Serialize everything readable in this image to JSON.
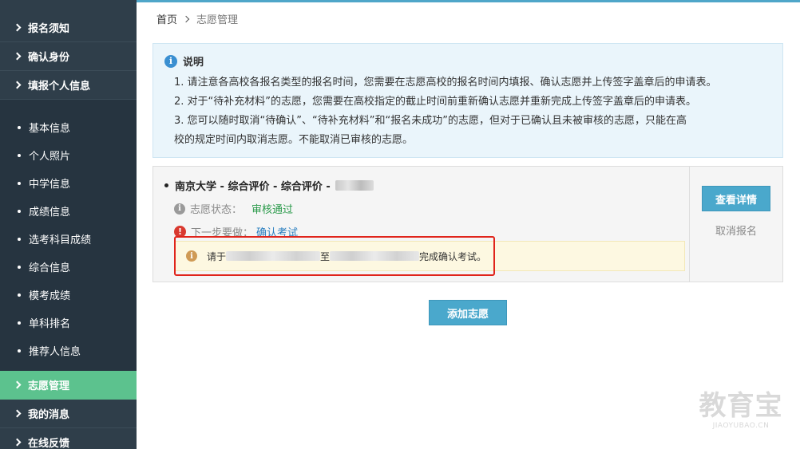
{
  "sidebar": {
    "top_items": [
      {
        "label": "报名须知"
      },
      {
        "label": "确认身份"
      },
      {
        "label": "填报个人信息"
      }
    ],
    "sub_items": [
      {
        "label": "基本信息"
      },
      {
        "label": "个人照片"
      },
      {
        "label": "中学信息"
      },
      {
        "label": "成绩信息"
      },
      {
        "label": "选考科目成绩"
      },
      {
        "label": "综合信息"
      },
      {
        "label": "模考成绩"
      },
      {
        "label": "单科排名"
      },
      {
        "label": "推荐人信息"
      }
    ],
    "bottom_items": [
      {
        "label": "志愿管理",
        "active": true
      },
      {
        "label": "我的消息"
      },
      {
        "label": "在线反馈"
      }
    ]
  },
  "breadcrumb": {
    "home": "首页",
    "current": "志愿管理"
  },
  "notice": {
    "title": "说明",
    "lines": [
      "1. 请注意各高校各报名类型的报名时间，您需要在志愿高校的报名时间内填报、确认志愿并上传签字盖章后的申请表。",
      "2. 对于“待补充材料”的志愿，您需要在高校指定的截止时间前重新确认志愿并重新完成上传签字盖章后的申请表。",
      "3. 您可以随时取消“待确认”、“待补充材料”和“报名未成功”的志愿，但对于已确认且未被审核的志愿，只能在高",
      "校的规定时间内取消志愿。不能取消已审核的志愿。"
    ]
  },
  "application": {
    "title": "南京大学 - 综合评价 - 综合评价 -",
    "status_label": "志愿状态：",
    "status_value": "审核通过",
    "next_label": "下一步要做：",
    "next_action": "确认考试",
    "tip_prefix": "请于",
    "tip_mid": "至",
    "tip_suffix": "完成确认考试。",
    "detail_button": "查看详情",
    "cancel_link": "取消报名"
  },
  "add_button": "添加志愿",
  "watermark": {
    "main": "教育宝",
    "sub": "JIAOYUBAO.CN"
  },
  "colors": {
    "sidebar_bg": "#2f3e4a",
    "sidebar_sub_bg": "#263440",
    "active_green": "#5cc28e",
    "button_blue": "#4aa8cc",
    "status_green": "#2a9a4a",
    "link_blue": "#2a7fc0",
    "highlight_red": "#e0241b"
  }
}
